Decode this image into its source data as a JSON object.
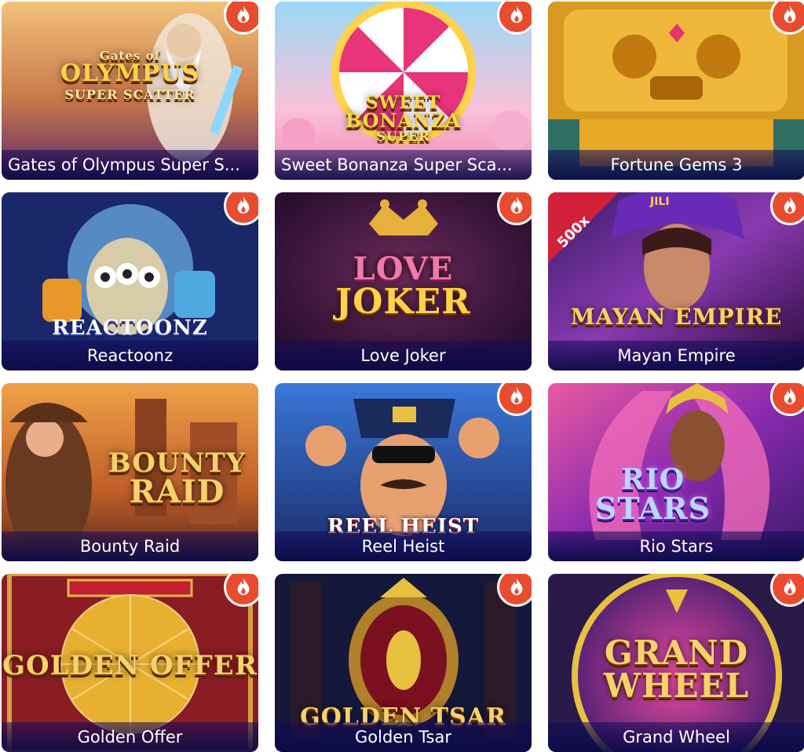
{
  "games": [
    {
      "title": "Gates of Olympus Super Scatter",
      "caption": "Gates of Olympus Super S...",
      "logo": "Gates of OLYMPUS SUPER SCATTER",
      "hot": true,
      "colors": [
        "#e8a55a",
        "#7b3b8c"
      ]
    },
    {
      "title": "Sweet Bonanza Super Scatter",
      "caption": "Sweet Bonanza Super Sca...",
      "logo": "SWEET BONANZA SUPER",
      "hot": true,
      "colors": [
        "#f6b7d2",
        "#8ed4f2"
      ]
    },
    {
      "title": "Fortune Gems 3",
      "caption": "Fortune Gems 3",
      "logo": "FORTUNE GEMS 3",
      "hot": true,
      "colors": [
        "#d69a1e",
        "#2a6b5e"
      ]
    },
    {
      "title": "Reactoonz",
      "caption": "Reactoonz",
      "logo": "REACTOONZ",
      "hot": true,
      "colors": [
        "#1d2b6b",
        "#3a8ad6"
      ]
    },
    {
      "title": "Love Joker",
      "caption": "Love Joker",
      "logo": "LOVE JOKER",
      "hot": true,
      "colors": [
        "#3a1240",
        "#7a2a5e"
      ]
    },
    {
      "title": "Mayan Empire",
      "caption": "Mayan Empire",
      "logo": "MAYAN EMPIRE",
      "badge": "500x",
      "brand": "JILI",
      "hot": true,
      "colors": [
        "#6a2c8c",
        "#d23a3a"
      ]
    },
    {
      "title": "Bounty Raid",
      "caption": "Bounty Raid",
      "logo": "BOUNTY RAID",
      "hot": false,
      "colors": [
        "#c56a2a",
        "#5a2e1a"
      ]
    },
    {
      "title": "Reel Heist",
      "caption": "Reel Heist",
      "logo": "REEL HEIST",
      "hot": true,
      "colors": [
        "#2c5fb8",
        "#1a2a66"
      ]
    },
    {
      "title": "Rio Stars",
      "caption": "Rio Stars",
      "logo": "RIO STARS",
      "hot": true,
      "colors": [
        "#7a2d9c",
        "#e24fa0"
      ]
    },
    {
      "title": "Golden Offer",
      "caption": "Golden Offer",
      "logo": "GOLDEN OFFER",
      "hot": true,
      "colors": [
        "#8a1c24",
        "#e2a23a"
      ]
    },
    {
      "title": "Golden Tsar",
      "caption": "Golden Tsar",
      "logo": "GOLDEN TSAR",
      "hot": true,
      "colors": [
        "#1a1d3a",
        "#6a1c2a"
      ]
    },
    {
      "title": "Grand Wheel",
      "caption": "Grand Wheel",
      "logo": "GRAND WHEEL",
      "hot": true,
      "colors": [
        "#3a2a8a",
        "#c03a8a"
      ]
    }
  ],
  "icons": {
    "hot": "flame-icon"
  }
}
